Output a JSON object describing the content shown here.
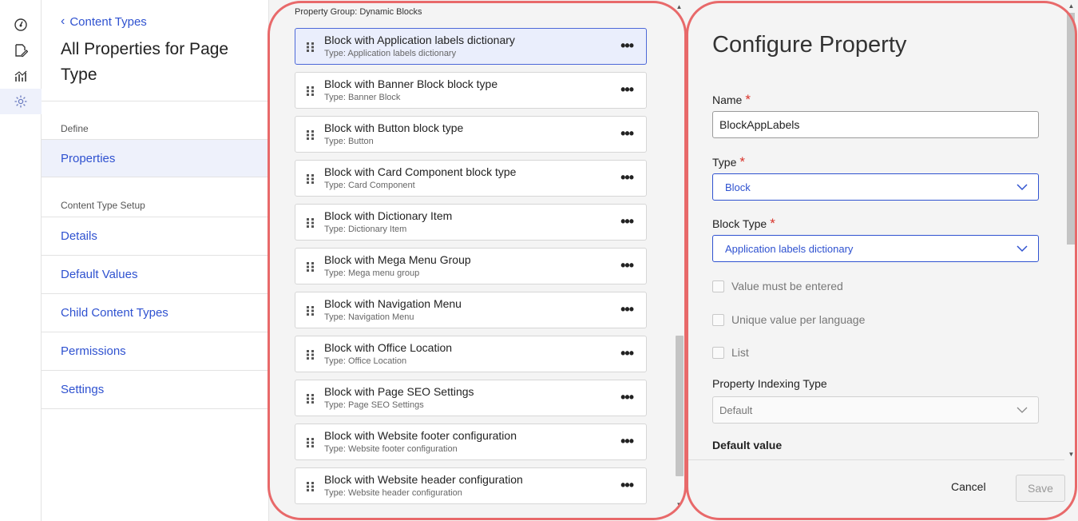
{
  "rail": {
    "icons": [
      "dashboard-icon",
      "edit-document-icon",
      "analytics-icon",
      "settings-icon"
    ]
  },
  "nav": {
    "back_label": "Content Types",
    "heading": "All Properties for Page Type",
    "section_define": "Define",
    "properties": "Properties",
    "section_setup": "Content Type Setup",
    "items": [
      "Details",
      "Default Values",
      "Child Content Types",
      "Permissions",
      "Settings"
    ]
  },
  "list": {
    "group_label": "Property Group: Dynamic Blocks",
    "more_label": "•••",
    "rows": [
      {
        "name": "Block with Application labels dictionary",
        "type": "Type: Application labels dictionary"
      },
      {
        "name": "Block with Banner Block block type",
        "type": "Type: Banner Block"
      },
      {
        "name": "Block with Button block type",
        "type": "Type: Button"
      },
      {
        "name": "Block with Card Component block type",
        "type": "Type: Card Component"
      },
      {
        "name": "Block with Dictionary Item",
        "type": "Type: Dictionary Item"
      },
      {
        "name": "Block with Mega Menu Group",
        "type": "Type: Mega menu group"
      },
      {
        "name": "Block with Navigation Menu",
        "type": "Type: Navigation Menu"
      },
      {
        "name": "Block with Office Location",
        "type": "Type: Office Location"
      },
      {
        "name": "Block with Page SEO Settings",
        "type": "Type: Page SEO Settings"
      },
      {
        "name": "Block with Website footer configuration",
        "type": "Type: Website footer configuration"
      },
      {
        "name": "Block with Website header configuration",
        "type": "Type: Website header configuration"
      }
    ]
  },
  "config": {
    "title": "Configure Property",
    "name_label": "Name",
    "name_value": "BlockAppLabels",
    "type_label": "Type",
    "type_value": "Block",
    "block_type_label": "Block Type",
    "block_type_value": "Application labels dictionary",
    "chk_required": "Value must be entered",
    "chk_unique": "Unique value per language",
    "chk_list": "List",
    "indexing_label": "Property Indexing Type",
    "indexing_value": "Default",
    "default_value_head": "Default value",
    "required_mark": "*",
    "cancel": "Cancel",
    "save": "Save"
  },
  "colors": {
    "accent": "#2f52d0",
    "highlight": "#e8696a",
    "required": "#d9342b"
  }
}
